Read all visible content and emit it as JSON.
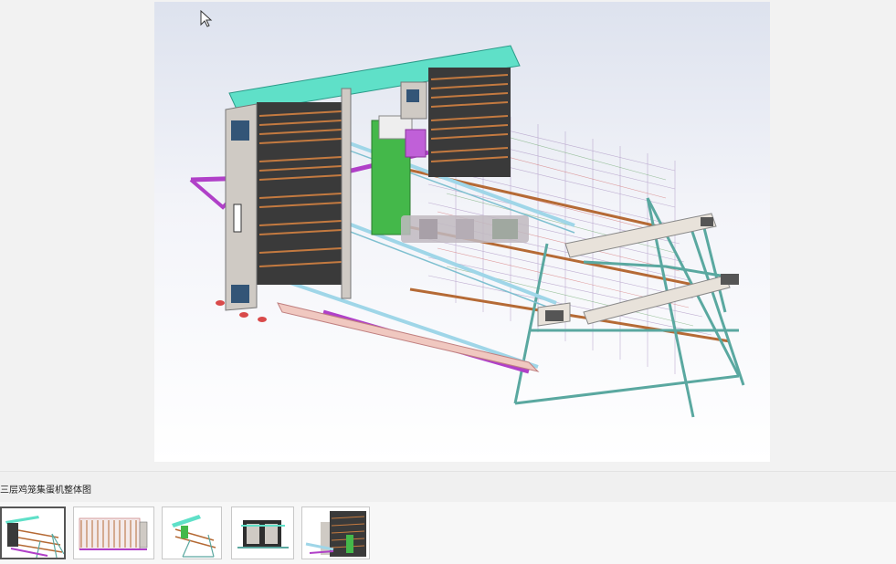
{
  "caption": "三层鸡笼集蛋机整体图",
  "images": {
    "main": {
      "name": "egg-collector-assembly-render"
    },
    "thumbnails": [
      {
        "name": "thumb-isometric",
        "selected": true
      },
      {
        "name": "thumb-front-view",
        "selected": false
      },
      {
        "name": "thumb-top-view",
        "selected": false
      },
      {
        "name": "thumb-side-view",
        "selected": false
      },
      {
        "name": "thumb-detail-view",
        "selected": false
      }
    ]
  },
  "colors": {
    "cyan_frame": "#5fe0c8",
    "grey_panel": "#cfcac4",
    "magenta_bar": "#b040c8",
    "green_motor": "#44b84a",
    "copper_rods": "#b56a35",
    "teal_legs": "#5aa8a0"
  },
  "icons": {
    "cursor": "mouse-pointer-icon"
  }
}
